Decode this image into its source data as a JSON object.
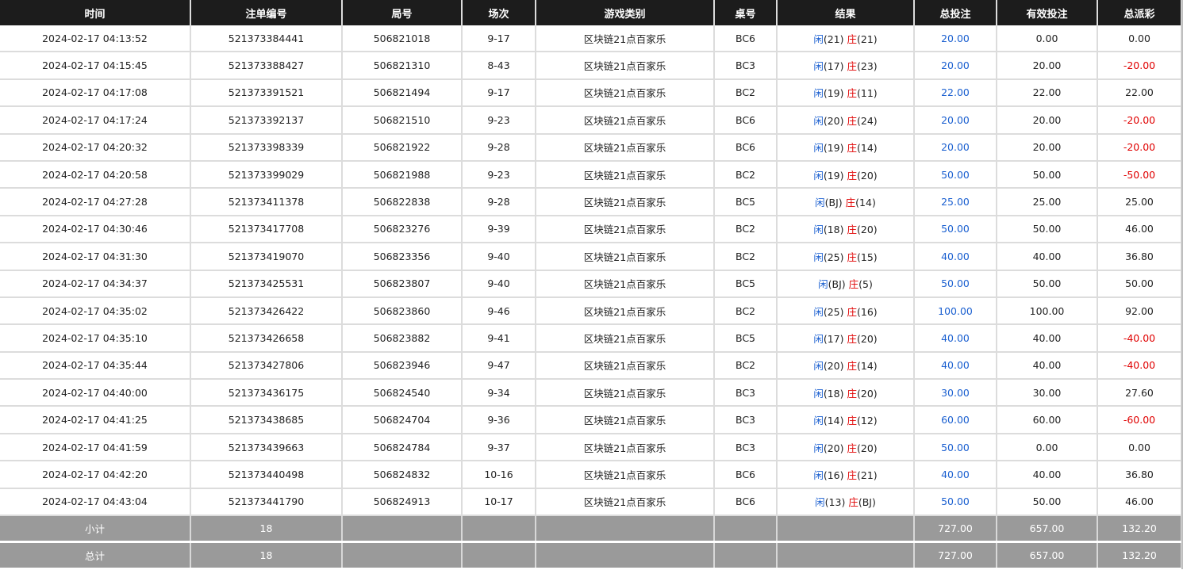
{
  "headers": [
    "时间",
    "注单编号",
    "局号",
    "场次",
    "游戏类别",
    "桌号",
    "结果",
    "总投注",
    "有效投注",
    "总派彩"
  ],
  "colors": {
    "header_bg": "#1c1c1c",
    "footer_bg": "#9a9a9a",
    "blue": "#1a5fd0",
    "red": "#e00000"
  },
  "result_labels": {
    "player": "闲",
    "banker": "庄"
  },
  "rows": [
    {
      "time": "2024-02-17 04:13:52",
      "order": "521373384441",
      "round": "506821018",
      "game_no": "9-17",
      "type": "区块链21点百家乐",
      "table": "BC6",
      "player": "(21)",
      "banker": "(21)",
      "total": "20.00",
      "valid": "0.00",
      "payout": "0.00",
      "payout_neg": false
    },
    {
      "time": "2024-02-17 04:15:45",
      "order": "521373388427",
      "round": "506821310",
      "game_no": "8-43",
      "type": "区块链21点百家乐",
      "table": "BC3",
      "player": "(17)",
      "banker": "(23)",
      "total": "20.00",
      "valid": "20.00",
      "payout": "-20.00",
      "payout_neg": true
    },
    {
      "time": "2024-02-17 04:17:08",
      "order": "521373391521",
      "round": "506821494",
      "game_no": "9-17",
      "type": "区块链21点百家乐",
      "table": "BC2",
      "player": "(19)",
      "banker": "(11)",
      "total": "22.00",
      "valid": "22.00",
      "payout": "22.00",
      "payout_neg": false
    },
    {
      "time": "2024-02-17 04:17:24",
      "order": "521373392137",
      "round": "506821510",
      "game_no": "9-23",
      "type": "区块链21点百家乐",
      "table": "BC6",
      "player": "(20)",
      "banker": "(24)",
      "total": "20.00",
      "valid": "20.00",
      "payout": "-20.00",
      "payout_neg": true
    },
    {
      "time": "2024-02-17 04:20:32",
      "order": "521373398339",
      "round": "506821922",
      "game_no": "9-28",
      "type": "区块链21点百家乐",
      "table": "BC6",
      "player": "(19)",
      "banker": "(14)",
      "total": "20.00",
      "valid": "20.00",
      "payout": "-20.00",
      "payout_neg": true
    },
    {
      "time": "2024-02-17 04:20:58",
      "order": "521373399029",
      "round": "506821988",
      "game_no": "9-23",
      "type": "区块链21点百家乐",
      "table": "BC2",
      "player": "(19)",
      "banker": "(20)",
      "total": "50.00",
      "valid": "50.00",
      "payout": "-50.00",
      "payout_neg": true
    },
    {
      "time": "2024-02-17 04:27:28",
      "order": "521373411378",
      "round": "506822838",
      "game_no": "9-28",
      "type": "区块链21点百家乐",
      "table": "BC5",
      "player": "(BJ)",
      "banker": "(14)",
      "total": "25.00",
      "valid": "25.00",
      "payout": "25.00",
      "payout_neg": false
    },
    {
      "time": "2024-02-17 04:30:46",
      "order": "521373417708",
      "round": "506823276",
      "game_no": "9-39",
      "type": "区块链21点百家乐",
      "table": "BC2",
      "player": "(18)",
      "banker": "(20)",
      "total": "50.00",
      "valid": "50.00",
      "payout": "46.00",
      "payout_neg": false
    },
    {
      "time": "2024-02-17 04:31:30",
      "order": "521373419070",
      "round": "506823356",
      "game_no": "9-40",
      "type": "区块链21点百家乐",
      "table": "BC2",
      "player": "(25)",
      "banker": "(15)",
      "total": "40.00",
      "valid": "40.00",
      "payout": "36.80",
      "payout_neg": false
    },
    {
      "time": "2024-02-17 04:34:37",
      "order": "521373425531",
      "round": "506823807",
      "game_no": "9-40",
      "type": "区块链21点百家乐",
      "table": "BC5",
      "player": "(BJ)",
      "banker": "(5)",
      "total": "50.00",
      "valid": "50.00",
      "payout": "50.00",
      "payout_neg": false
    },
    {
      "time": "2024-02-17 04:35:02",
      "order": "521373426422",
      "round": "506823860",
      "game_no": "9-46",
      "type": "区块链21点百家乐",
      "table": "BC2",
      "player": "(25)",
      "banker": "(16)",
      "total": "100.00",
      "valid": "100.00",
      "payout": "92.00",
      "payout_neg": false
    },
    {
      "time": "2024-02-17 04:35:10",
      "order": "521373426658",
      "round": "506823882",
      "game_no": "9-41",
      "type": "区块链21点百家乐",
      "table": "BC5",
      "player": "(17)",
      "banker": "(20)",
      "total": "40.00",
      "valid": "40.00",
      "payout": "-40.00",
      "payout_neg": true
    },
    {
      "time": "2024-02-17 04:35:44",
      "order": "521373427806",
      "round": "506823946",
      "game_no": "9-47",
      "type": "区块链21点百家乐",
      "table": "BC2",
      "player": "(20)",
      "banker": "(14)",
      "total": "40.00",
      "valid": "40.00",
      "payout": "-40.00",
      "payout_neg": true
    },
    {
      "time": "2024-02-17 04:40:00",
      "order": "521373436175",
      "round": "506824540",
      "game_no": "9-34",
      "type": "区块链21点百家乐",
      "table": "BC3",
      "player": "(18)",
      "banker": "(20)",
      "total": "30.00",
      "valid": "30.00",
      "payout": "27.60",
      "payout_neg": false
    },
    {
      "time": "2024-02-17 04:41:25",
      "order": "521373438685",
      "round": "506824704",
      "game_no": "9-36",
      "type": "区块链21点百家乐",
      "table": "BC3",
      "player": "(14)",
      "banker": "(12)",
      "total": "60.00",
      "valid": "60.00",
      "payout": "-60.00",
      "payout_neg": true
    },
    {
      "time": "2024-02-17 04:41:59",
      "order": "521373439663",
      "round": "506824784",
      "game_no": "9-37",
      "type": "区块链21点百家乐",
      "table": "BC3",
      "player": "(20)",
      "banker": "(20)",
      "total": "50.00",
      "valid": "0.00",
      "payout": "0.00",
      "payout_neg": false
    },
    {
      "time": "2024-02-17 04:42:20",
      "order": "521373440498",
      "round": "506824832",
      "game_no": "10-16",
      "type": "区块链21点百家乐",
      "table": "BC6",
      "player": "(16)",
      "banker": "(21)",
      "total": "40.00",
      "valid": "40.00",
      "payout": "36.80",
      "payout_neg": false
    },
    {
      "time": "2024-02-17 04:43:04",
      "order": "521373441790",
      "round": "506824913",
      "game_no": "10-17",
      "type": "区块链21点百家乐",
      "table": "BC6",
      "player": "(13)",
      "banker": "(BJ)",
      "total": "50.00",
      "valid": "50.00",
      "payout": "46.00",
      "payout_neg": false
    }
  ],
  "subtotal": {
    "label": "小计",
    "count": "18",
    "total": "727.00",
    "valid": "657.00",
    "payout": "132.20"
  },
  "grand_total": {
    "label": "总计",
    "count": "18",
    "total": "727.00",
    "valid": "657.00",
    "payout": "132.20"
  }
}
